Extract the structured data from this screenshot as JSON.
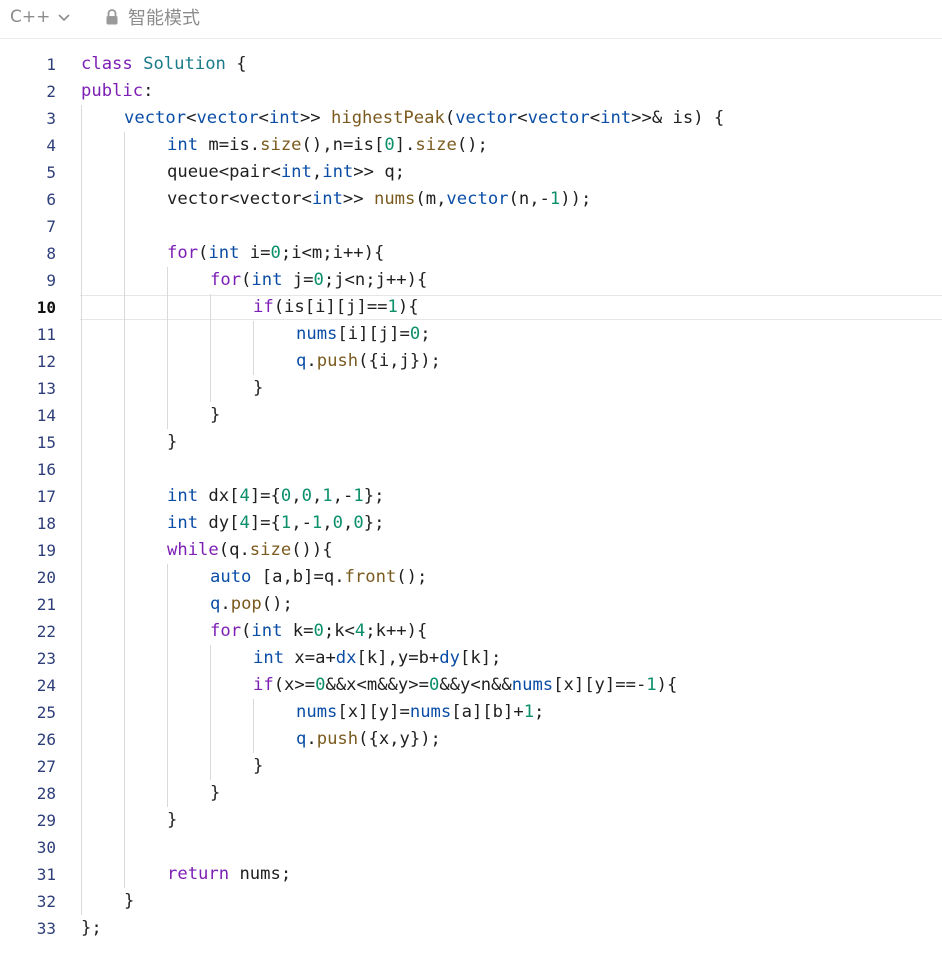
{
  "toolbar": {
    "language": "C++",
    "mode": "智能模式"
  },
  "editor": {
    "active_line": 10,
    "lines": [
      {
        "n": "1",
        "indent": 0,
        "tokens": [
          [
            "kw",
            "class"
          ],
          [
            "op",
            " "
          ],
          [
            "cls",
            "Solution"
          ],
          [
            "op",
            " {"
          ]
        ]
      },
      {
        "n": "2",
        "indent": 0,
        "tokens": [
          [
            "kw",
            "public"
          ],
          [
            "op",
            ":"
          ]
        ]
      },
      {
        "n": "3",
        "indent": 1,
        "tokens": [
          [
            "ty",
            "vector"
          ],
          [
            "op",
            "<"
          ],
          [
            "ty",
            "vector"
          ],
          [
            "op",
            "<"
          ],
          [
            "ty",
            "int"
          ],
          [
            "op",
            ">> "
          ],
          [
            "fn",
            "highestPeak"
          ],
          [
            "op",
            "("
          ],
          [
            "ty",
            "vector"
          ],
          [
            "op",
            "<"
          ],
          [
            "ty",
            "vector"
          ],
          [
            "op",
            "<"
          ],
          [
            "ty",
            "int"
          ],
          [
            "op",
            ">>& is) {"
          ]
        ]
      },
      {
        "n": "4",
        "indent": 2,
        "tokens": [
          [
            "ty",
            "int"
          ],
          [
            "op",
            " m=is."
          ],
          [
            "fn",
            "size"
          ],
          [
            "op",
            "(),n=is["
          ],
          [
            "num",
            "0"
          ],
          [
            "op",
            "]."
          ],
          [
            "fn",
            "size"
          ],
          [
            "op",
            "();"
          ]
        ]
      },
      {
        "n": "5",
        "indent": 2,
        "tokens": [
          [
            "op",
            "queue<pair<"
          ],
          [
            "ty",
            "int"
          ],
          [
            "op",
            ","
          ],
          [
            "ty",
            "int"
          ],
          [
            "op",
            ">> q;"
          ]
        ]
      },
      {
        "n": "6",
        "indent": 2,
        "tokens": [
          [
            "op",
            "vector<vector<"
          ],
          [
            "ty",
            "int"
          ],
          [
            "op",
            ">> "
          ],
          [
            "fn",
            "nums"
          ],
          [
            "op",
            "(m,"
          ],
          [
            "ty",
            "vector"
          ],
          [
            "op",
            "(n,-"
          ],
          [
            "num",
            "1"
          ],
          [
            "op",
            "));"
          ]
        ]
      },
      {
        "n": "7",
        "indent": 0,
        "tokens": []
      },
      {
        "n": "8",
        "indent": 2,
        "tokens": [
          [
            "kw",
            "for"
          ],
          [
            "op",
            "("
          ],
          [
            "ty",
            "int"
          ],
          [
            "op",
            " i="
          ],
          [
            "num",
            "0"
          ],
          [
            "op",
            ";i<m;i++){"
          ]
        ]
      },
      {
        "n": "9",
        "indent": 3,
        "tokens": [
          [
            "kw",
            "for"
          ],
          [
            "op",
            "("
          ],
          [
            "ty",
            "int"
          ],
          [
            "op",
            " j="
          ],
          [
            "num",
            "0"
          ],
          [
            "op",
            ";j<n;j++){"
          ]
        ]
      },
      {
        "n": "10",
        "indent": 4,
        "tokens": [
          [
            "kw",
            "if"
          ],
          [
            "op",
            "(is[i][j]=="
          ],
          [
            "num",
            "1"
          ],
          [
            "op",
            "){"
          ]
        ]
      },
      {
        "n": "11",
        "indent": 5,
        "tokens": [
          [
            "ty",
            "nums"
          ],
          [
            "op",
            "[i][j]="
          ],
          [
            "num",
            "0"
          ],
          [
            "op",
            ";"
          ]
        ]
      },
      {
        "n": "12",
        "indent": 5,
        "tokens": [
          [
            "ty",
            "q"
          ],
          [
            "op",
            "."
          ],
          [
            "fn",
            "push"
          ],
          [
            "op",
            "({i,j});"
          ]
        ]
      },
      {
        "n": "13",
        "indent": 4,
        "tokens": [
          [
            "op",
            "}"
          ]
        ]
      },
      {
        "n": "14",
        "indent": 3,
        "tokens": [
          [
            "op",
            "}"
          ]
        ]
      },
      {
        "n": "15",
        "indent": 2,
        "tokens": [
          [
            "op",
            "}"
          ]
        ]
      },
      {
        "n": "16",
        "indent": 0,
        "tokens": []
      },
      {
        "n": "17",
        "indent": 2,
        "tokens": [
          [
            "ty",
            "int"
          ],
          [
            "op",
            " dx["
          ],
          [
            "num",
            "4"
          ],
          [
            "op",
            "]={"
          ],
          [
            "num",
            "0"
          ],
          [
            "op",
            ","
          ],
          [
            "num",
            "0"
          ],
          [
            "op",
            ","
          ],
          [
            "num",
            "1"
          ],
          [
            "op",
            ",-"
          ],
          [
            "num",
            "1"
          ],
          [
            "op",
            "};"
          ]
        ]
      },
      {
        "n": "18",
        "indent": 2,
        "tokens": [
          [
            "ty",
            "int"
          ],
          [
            "op",
            " dy["
          ],
          [
            "num",
            "4"
          ],
          [
            "op",
            "]={"
          ],
          [
            "num",
            "1"
          ],
          [
            "op",
            ",-"
          ],
          [
            "num",
            "1"
          ],
          [
            "op",
            ","
          ],
          [
            "num",
            "0"
          ],
          [
            "op",
            ","
          ],
          [
            "num",
            "0"
          ],
          [
            "op",
            "};"
          ]
        ]
      },
      {
        "n": "19",
        "indent": 2,
        "tokens": [
          [
            "kw",
            "while"
          ],
          [
            "op",
            "(q."
          ],
          [
            "fn",
            "size"
          ],
          [
            "op",
            "()){"
          ]
        ]
      },
      {
        "n": "20",
        "indent": 3,
        "tokens": [
          [
            "ty",
            "auto"
          ],
          [
            "op",
            " [a,b]=q."
          ],
          [
            "fn",
            "front"
          ],
          [
            "op",
            "();"
          ]
        ]
      },
      {
        "n": "21",
        "indent": 3,
        "tokens": [
          [
            "ty",
            "q"
          ],
          [
            "op",
            "."
          ],
          [
            "fn",
            "pop"
          ],
          [
            "op",
            "();"
          ]
        ]
      },
      {
        "n": "22",
        "indent": 3,
        "tokens": [
          [
            "kw",
            "for"
          ],
          [
            "op",
            "("
          ],
          [
            "ty",
            "int"
          ],
          [
            "op",
            " k="
          ],
          [
            "num",
            "0"
          ],
          [
            "op",
            ";k<"
          ],
          [
            "num",
            "4"
          ],
          [
            "op",
            ";k++){"
          ]
        ]
      },
      {
        "n": "23",
        "indent": 4,
        "tokens": [
          [
            "ty",
            "int"
          ],
          [
            "op",
            " x=a+"
          ],
          [
            "ty",
            "dx"
          ],
          [
            "op",
            "[k],y=b+"
          ],
          [
            "ty",
            "dy"
          ],
          [
            "op",
            "[k];"
          ]
        ]
      },
      {
        "n": "24",
        "indent": 4,
        "tokens": [
          [
            "kw",
            "if"
          ],
          [
            "op",
            "(x>="
          ],
          [
            "num",
            "0"
          ],
          [
            "op",
            "&&x<m&&y>="
          ],
          [
            "num",
            "0"
          ],
          [
            "op",
            "&&y<n&&"
          ],
          [
            "ty",
            "nums"
          ],
          [
            "op",
            "[x][y]==-"
          ],
          [
            "num",
            "1"
          ],
          [
            "op",
            "){"
          ]
        ]
      },
      {
        "n": "25",
        "indent": 5,
        "tokens": [
          [
            "ty",
            "nums"
          ],
          [
            "op",
            "[x][y]="
          ],
          [
            "ty",
            "nums"
          ],
          [
            "op",
            "[a][b]+"
          ],
          [
            "num",
            "1"
          ],
          [
            "op",
            ";"
          ]
        ]
      },
      {
        "n": "26",
        "indent": 5,
        "tokens": [
          [
            "ty",
            "q"
          ],
          [
            "op",
            "."
          ],
          [
            "fn",
            "push"
          ],
          [
            "op",
            "({x,y});"
          ]
        ]
      },
      {
        "n": "27",
        "indent": 4,
        "tokens": [
          [
            "op",
            "}"
          ]
        ]
      },
      {
        "n": "28",
        "indent": 3,
        "tokens": [
          [
            "op",
            "}"
          ]
        ]
      },
      {
        "n": "29",
        "indent": 2,
        "tokens": [
          [
            "op",
            "}"
          ]
        ]
      },
      {
        "n": "30",
        "indent": 0,
        "tokens": []
      },
      {
        "n": "31",
        "indent": 2,
        "tokens": [
          [
            "kw",
            "return"
          ],
          [
            "op",
            " nums;"
          ]
        ]
      },
      {
        "n": "32",
        "indent": 1,
        "tokens": [
          [
            "op",
            "}"
          ]
        ]
      },
      {
        "n": "33",
        "indent": 0,
        "tokens": [
          [
            "op",
            "};"
          ]
        ]
      }
    ]
  },
  "colors": {
    "keyword": "#7d1fb5",
    "type": "#0a4da6",
    "class": "#1a7b8a",
    "function": "#7a5a1e",
    "number": "#0a8f6a"
  }
}
